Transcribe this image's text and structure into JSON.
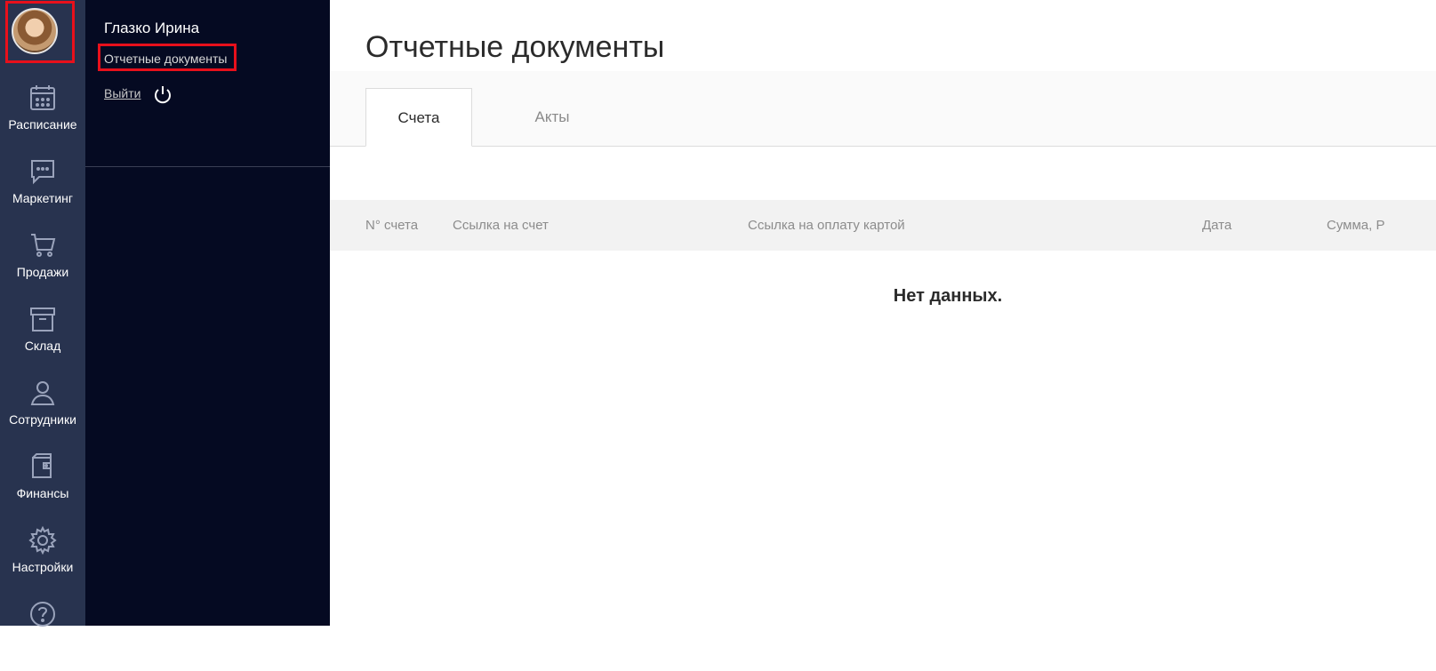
{
  "user": {
    "name": "Глазко Ирина",
    "docs_link": "Отчетные документы",
    "logout": "Выйти"
  },
  "rail": {
    "items": [
      {
        "label": "Расписание",
        "icon": "calendar-icon"
      },
      {
        "label": "Маркетинг",
        "icon": "chat-icon"
      },
      {
        "label": "Продажи",
        "icon": "cart-icon"
      },
      {
        "label": "Склад",
        "icon": "box-icon"
      },
      {
        "label": "Сотрудники",
        "icon": "person-icon"
      },
      {
        "label": "Финансы",
        "icon": "wallet-icon"
      },
      {
        "label": "Настройки",
        "icon": "gear-icon"
      },
      {
        "label": "",
        "icon": "help-icon"
      }
    ]
  },
  "page": {
    "title": "Отчетные документы",
    "tabs": [
      {
        "label": "Счета",
        "active": true
      },
      {
        "label": "Акты",
        "active": false
      }
    ],
    "table": {
      "columns": [
        "N° счета",
        "Ссылка на счет",
        "Ссылка на оплату картой",
        "Дата",
        "Сумма, Р"
      ]
    },
    "empty_text": "Нет данных."
  },
  "colors": {
    "rail_bg": "#28334f",
    "panel_bg": "#050a22",
    "highlight": "#e8101b"
  }
}
